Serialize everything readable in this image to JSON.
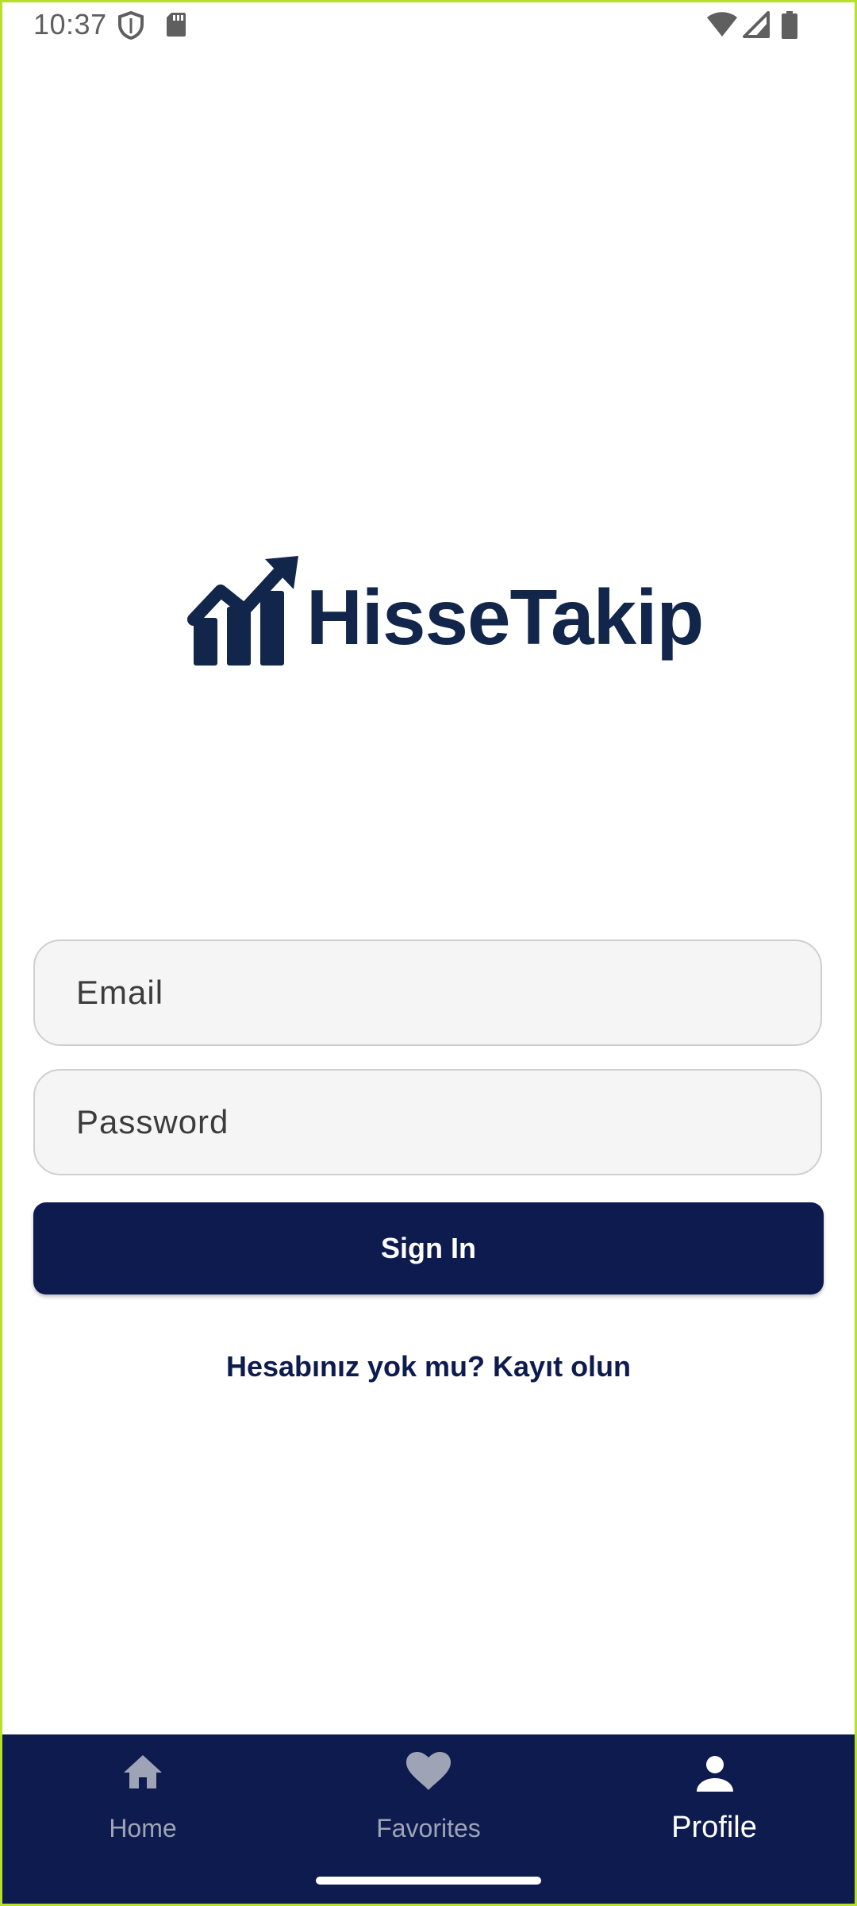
{
  "status_bar": {
    "time": "10:37",
    "icons": [
      "shield-icon",
      "sd-card-icon",
      "wifi-icon",
      "signal-icon",
      "battery-icon"
    ]
  },
  "logo": {
    "text": "HisseTakip",
    "icon": "stock-chart-icon",
    "color": "#12254a"
  },
  "form": {
    "email_placeholder": "Email",
    "password_placeholder": "Password",
    "sign_in_label": "Sign In",
    "register_link": "Hesabınız yok mu? Kayıt olun"
  },
  "bottom_nav": {
    "items": [
      {
        "label": "Home",
        "icon": "home-icon",
        "active": false
      },
      {
        "label": "Favorites",
        "icon": "heart-icon",
        "active": false
      },
      {
        "label": "Profile",
        "icon": "person-icon",
        "active": true
      }
    ]
  },
  "colors": {
    "primary": "#0d1b4f",
    "inactive_nav": "#9ea3b5",
    "input_bg": "#f5f5f5"
  }
}
